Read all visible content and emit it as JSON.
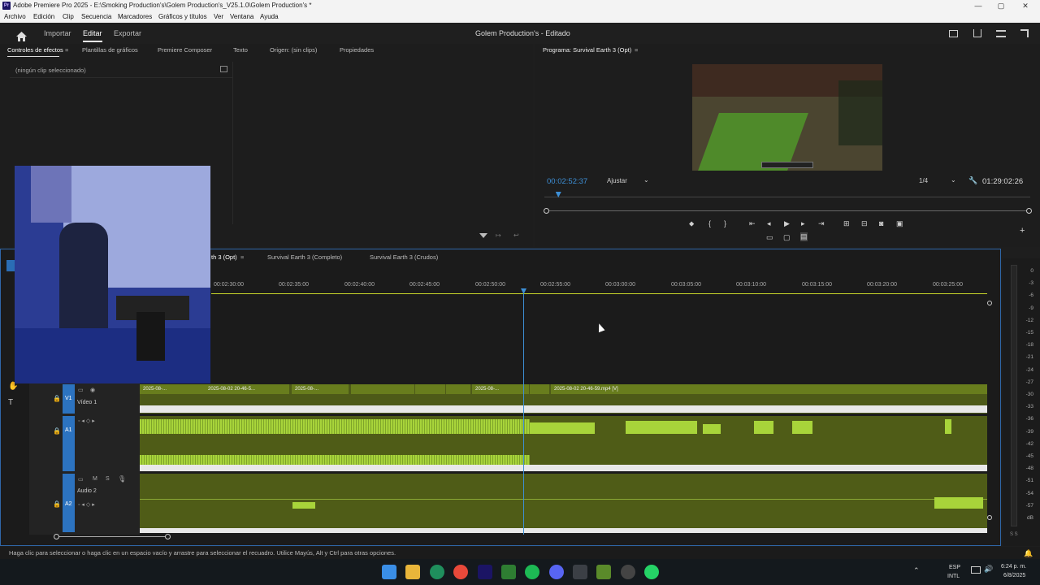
{
  "window": {
    "title": "Adobe Premiere Pro 2025 - E:\\Smoking Production's\\Golem Production's_V25.1.0\\Golem Production's *",
    "minimize": "—",
    "maximize": "▢",
    "close": "✕"
  },
  "menu": [
    "Archivo",
    "Edición",
    "Clip",
    "Secuencia",
    "Marcadores",
    "Gráficos y títulos",
    "Ver",
    "Ventana",
    "Ayuda"
  ],
  "topbar": {
    "tabs": [
      "Importar",
      "Editar",
      "Exportar"
    ],
    "active_tab": "Editar",
    "project_title": "Golem Production's - Editado"
  },
  "source_panel": {
    "tabs": [
      "Controles de efectos",
      "Plantillas de gráficos",
      "Premiere Composer",
      "Texto",
      "Origen: (sin clips)",
      "Propiedades"
    ],
    "empty_text": "(ningún clip seleccionado)"
  },
  "program_monitor": {
    "title": "Programa: Survival Earth 3 (Opt)",
    "timecode": "00:02:52:37",
    "fit": "Ajustar",
    "resolution": "1/4",
    "duration": "01:29:02:26",
    "playhead_fraction": 0.028
  },
  "timeline": {
    "tabs": [
      "Survival Earth 3 (Opt)",
      "Survival Earth 3 (Completo)",
      "Survival Earth 3 (Crudos)"
    ],
    "visible_tab_fragment": "th 3 (Opt)",
    "ruler": [
      "00:02:30:00",
      "00:02:35:00",
      "00:02:40:00",
      "00:02:45:00",
      "00:02:50:00",
      "00:02:55:00",
      "00:03:00:00",
      "00:03:05:00",
      "00:03:10:00",
      "00:03:15:00",
      "00:03:20:00",
      "00:03:25:00"
    ],
    "tracks": {
      "v1": {
        "id": "V1",
        "name": "Vídeo 1"
      },
      "a1": {
        "id": "A1"
      },
      "a2": {
        "id": "A2",
        "name": "Audio 2"
      }
    },
    "track_buttons": {
      "mute": "M",
      "solo": "S"
    },
    "clips": [
      "2025-08-...",
      "2025-08-02 20-46-5...",
      "2025-08-...",
      "2025-08-...",
      "2025-08-02 20-46-59.mp4 [V]"
    ],
    "clip_fx": "fx"
  },
  "meter": {
    "labels": [
      "0",
      "-3",
      "-6",
      "-9",
      "-12",
      "-15",
      "-18",
      "-21",
      "-24",
      "-27",
      "-30",
      "-33",
      "-36",
      "-39",
      "-42",
      "-45",
      "-48",
      "-51",
      "-54",
      "-57",
      "dB"
    ],
    "footer": "S S"
  },
  "status_bar": "Haga clic para seleccionar o haga clic en un espacio vacío y arrastre para seleccionar el recuadro. Utilice Mayús, Alt y Ctrl para otras opciones.",
  "taskbar": {
    "lang": "ESP",
    "layout": "INTL",
    "time": "6:24 p. m.",
    "date": "6/8/2025"
  },
  "colors": {
    "accent_blue": "#3d8fd6",
    "clip_green": "#7aa61f",
    "wave_green": "#a8d43a",
    "panel": "#1d1d1d"
  }
}
